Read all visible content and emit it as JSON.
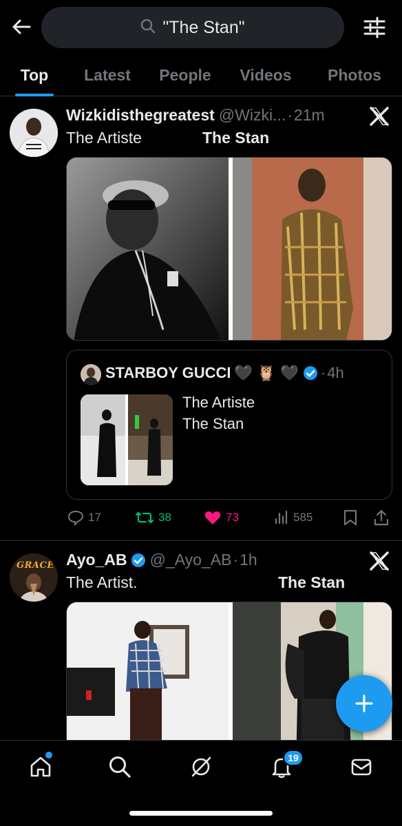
{
  "search": {
    "query": "\"The Stan\""
  },
  "tabs": [
    {
      "label": "Top",
      "active": true
    },
    {
      "label": "Latest"
    },
    {
      "label": "People"
    },
    {
      "label": "Videos"
    },
    {
      "label": "Photos"
    }
  ],
  "tweets": [
    {
      "name": "Wizkidisthegreatest",
      "handle": "@Wizki...",
      "time": "21m",
      "text_left": "The Artiste",
      "text_right": "The Stan",
      "quote": {
        "name": "STARBOY GUCCI",
        "emojis": "🖤 🦉 🖤",
        "time": "4h",
        "line1": "The Artiste",
        "line2": "The Stan"
      },
      "stats": {
        "replies": "17",
        "reposts": "38",
        "likes": "73",
        "views": "585"
      }
    },
    {
      "name": "Ayo_AB",
      "handle": "@_Ayo_AB",
      "time": "1h",
      "text_left": "The Artist.",
      "text_right": "The Stan",
      "avatar_text": "GRACE"
    }
  ],
  "notifications": {
    "count": "19"
  },
  "colors": {
    "accent": "#1d9bf0",
    "like": "#f91880",
    "repost": "#00ba7c",
    "muted": "#71767b"
  }
}
